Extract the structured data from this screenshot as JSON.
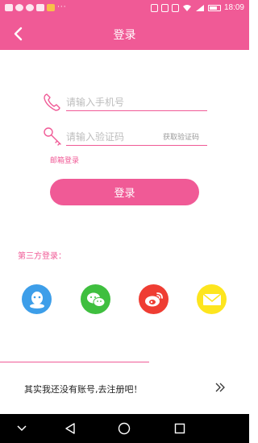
{
  "status_bar": {
    "time": "18:09"
  },
  "header": {
    "title": "登录"
  },
  "form": {
    "phone_placeholder": "请输入手机号",
    "code_placeholder": "请输入验证码",
    "get_code_label": "获取验证码",
    "email_login_label": "邮箱登录",
    "login_label": "登录"
  },
  "third_party": {
    "label": "第三方登录：",
    "providers": [
      "qq-icon",
      "wechat-icon",
      "weibo-icon",
      "mail-icon"
    ],
    "colors": {
      "qq": "#3d9ee9",
      "wechat": "#3fbf3f",
      "weibo": "#ef3d33",
      "mail": "#fde51e"
    }
  },
  "register": {
    "text": "其实我还没有账号,去注册吧！"
  },
  "theme": {
    "accent": "#f05a96"
  }
}
